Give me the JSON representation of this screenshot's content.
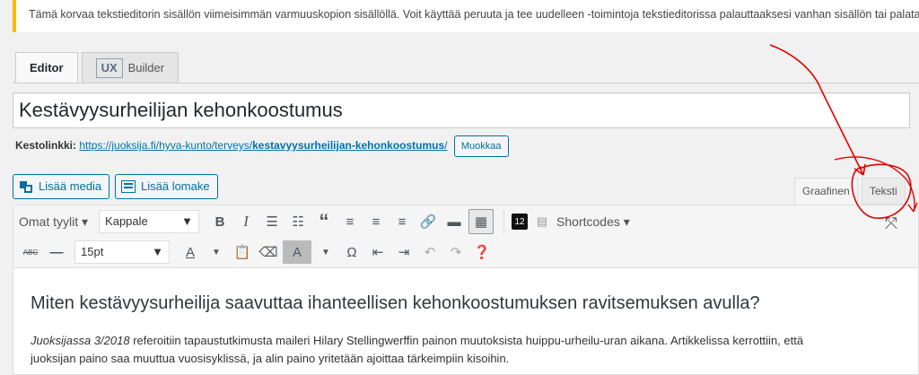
{
  "notice": {
    "text": "Tämä korvaa tekstieditorin sisällön viimeisimmän varmuuskopion sisällöllä. Voit käyttää peruuta ja tee uudelleen -toimintoja tekstieditorissa palauttaaksesi vanhan sisällön tai palata"
  },
  "tabs": {
    "editor": "Editor",
    "ux_badge": "UX",
    "builder": "Builder"
  },
  "post": {
    "title": "Kestävyysurheilijan kehonkoostumus"
  },
  "permalink": {
    "label": "Kestolinkki:",
    "base": "https://juoksija.fi/hyva-kunto/terveys/",
    "slug": "kestavyysurheilijan-kehonkoostumus",
    "trail": "/",
    "edit": "Muokkaa"
  },
  "media_buttons": {
    "add_media": "Lisää media",
    "add_form": "Lisää lomake"
  },
  "mode_tabs": {
    "visual": "Graafinen",
    "text": "Teksti"
  },
  "toolbar": {
    "styles": "Omat tyylit ▾",
    "format": "Kappale",
    "font_size": "15pt",
    "shortcodes": "Shortcodes ▾",
    "badge_12": "12",
    "strike": "ABC"
  },
  "content": {
    "heading": "Miten kestävyysurheilija saavuttaa ihanteellisen kehonkoostumuksen ravitsemuksen avulla?",
    "para_italic": "Juoksijassa 3/2018",
    "para_rest": " refer­oitiin tapaustutkimusta maileri Hilary Stellingwerffin painon muutoksista huippu-urheilu-uran aikana. Artikkelissa kerrottiin, että",
    "para_line2": "juoksijan paino saa muuttua vuosisyklissä, ja alin paino yritetään ajoittaa tärkeimpiin kisoihin."
  },
  "colors": {
    "accent": "#0073aa",
    "notice_border": "#ffb900",
    "annotation": "#e00000"
  }
}
